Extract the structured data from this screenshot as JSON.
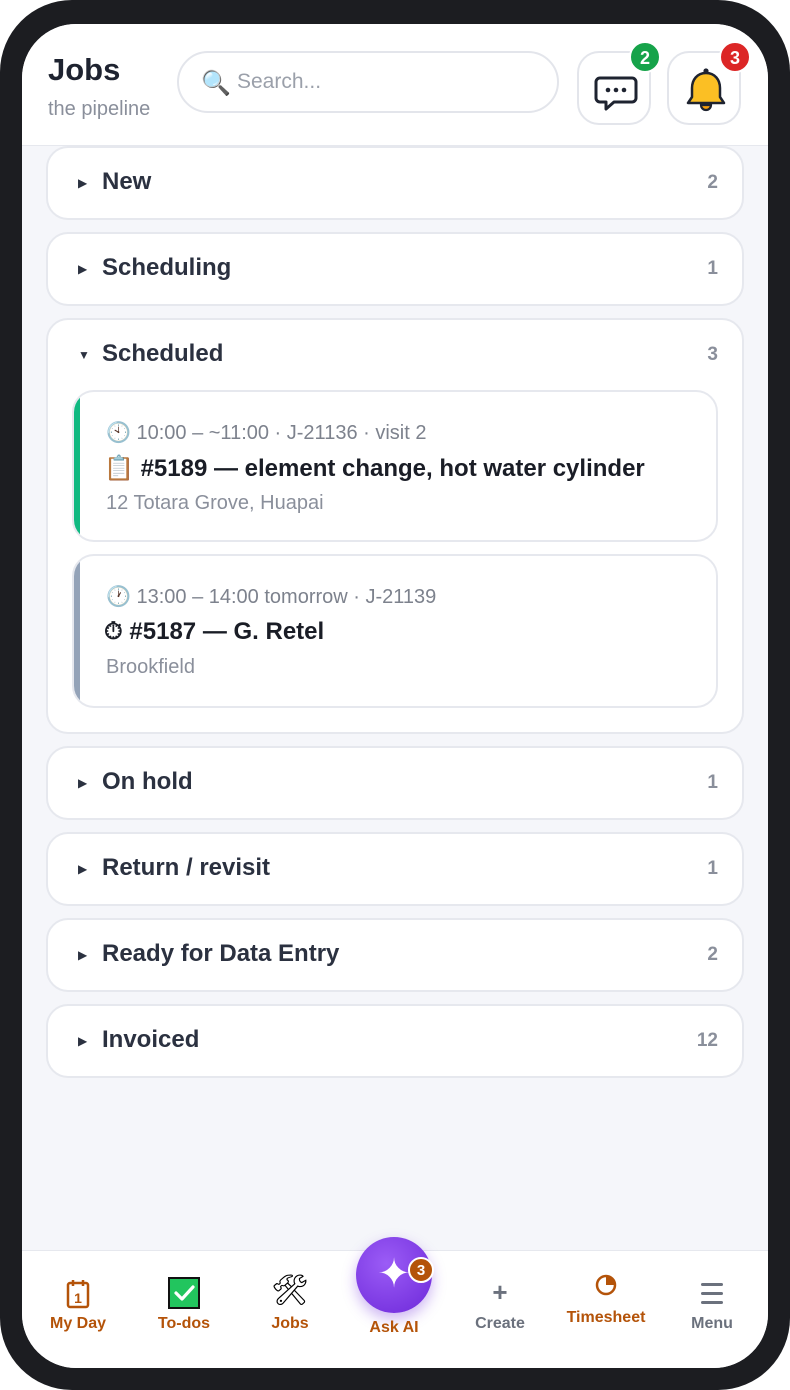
{
  "header": {
    "title": "Jobs",
    "subtitle": "the pipeline",
    "search_placeholder": "Search...",
    "messages_badge": "2",
    "notifications_badge": "3"
  },
  "sections": [
    {
      "label": "New",
      "count": "2",
      "expanded": false
    },
    {
      "label": "Scheduling",
      "count": "1",
      "expanded": false
    },
    {
      "label": "Scheduled",
      "count": "3",
      "expanded": true
    },
    {
      "label": "On hold",
      "count": "1",
      "expanded": false
    },
    {
      "label": "Return / revisit",
      "count": "1",
      "expanded": false
    },
    {
      "label": "Ready for Data Entry",
      "count": "2",
      "expanded": false
    },
    {
      "label": "Invoiced",
      "count": "12",
      "expanded": false
    }
  ],
  "scheduled_jobs": [
    {
      "meta": "10:00 – ~11:00 · J-21136 · visit 2",
      "title": "#5189 — element change, hot water cylinder",
      "title_icon": "clipboard-icon",
      "address": "12 Totara Grove, Huapai",
      "accent": "#10b981"
    },
    {
      "meta": "13:00 – 14:00 tomorrow · J-21139",
      "title": "#5187 — G. Retel",
      "title_icon": "stopwatch-icon",
      "address": "Brookfield",
      "accent": "#94a3b8"
    }
  ],
  "nav": {
    "my_day": "My Day",
    "todos": "To-dos",
    "jobs": "Jobs",
    "ask_ai": "Ask AI",
    "ask_ai_badge": "3",
    "create": "Create",
    "timesheet": "Timesheet",
    "menu": "Menu"
  },
  "colors": {
    "accent_orange": "#b45309",
    "ai_purple": "#7c3aed",
    "badge_green": "#16a34a",
    "badge_red": "#dc2626"
  }
}
